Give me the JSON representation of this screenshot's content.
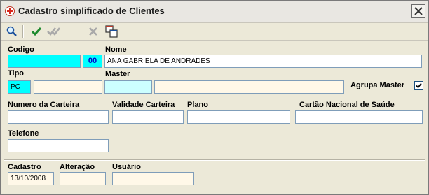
{
  "window": {
    "title": "Cadastro simplificado de Clientes"
  },
  "toolbar": {
    "buttons": [
      "search-icon",
      "confirm-icon",
      "confirm-all-icon",
      "cancel-icon",
      "window-swap-icon"
    ]
  },
  "form": {
    "codigo_label": "Codigo",
    "codigo_value": "",
    "codigo_suffix": "00",
    "nome_label": "Nome",
    "nome_value": "ANA GABRIELA DE ANDRADES",
    "tipo_label": "Tipo",
    "tipo_value": "PC",
    "tipo_desc": "",
    "master_label": "Master",
    "master_code": "",
    "master_desc": "",
    "agrupa_master_label": "Agrupa Master",
    "agrupa_master_checked": true,
    "numero_carteira_label": "Numero da Carteira",
    "numero_carteira_value": "",
    "validade_carteira_label": "Validade Carteira",
    "validade_carteira_value": "",
    "plano_label": "Plano",
    "plano_value": "",
    "cartao_nacional_label": "Cartão Nacional de Saúde",
    "cartao_nacional_value": "",
    "telefone_label": "Telefone",
    "telefone_value": "",
    "cadastro_label": "Cadastro",
    "cadastro_value": "13/10/2008",
    "alteracao_label": "Alteração",
    "alteracao_value": "",
    "usuario_label": "Usuário",
    "usuario_value": ""
  },
  "colors": {
    "cyan_field": "#00ffff",
    "light_cyan_field": "#ccffff",
    "beige_field": "#fff8e8",
    "code_text": "#0000cc"
  }
}
